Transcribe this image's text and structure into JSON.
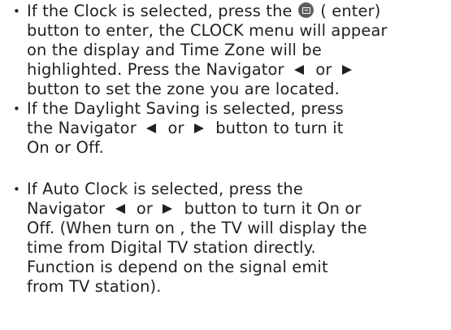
{
  "bullet_symbol": "•",
  "icons": {
    "enter": "enter-button-icon",
    "left": "navigator-left-icon",
    "right": "navigator-right-icon"
  },
  "items": [
    {
      "lines": [
        {
          "a": "If the Clock is selected, press the ",
          "b": " ( enter)"
        },
        {
          "a": "button to enter, the CLOCK menu will appear"
        },
        {
          "a": "on the display and Time Zone will be"
        },
        {
          "a": "highlighted. Press the Navigator ",
          "b": " or "
        },
        {
          "a": "button to set the zone you are located."
        }
      ]
    },
    {
      "lines": [
        {
          "a": "If the Daylight Saving is selected, press"
        },
        {
          "a": "the Navigator ",
          "b": " or ",
          "c": " button to turn it"
        },
        {
          "a": "On or Off."
        }
      ]
    },
    {
      "lines": [
        {
          "a": "If Auto Clock is selected, press the"
        },
        {
          "a": "Navigator ",
          "b": " or ",
          "c": " button to turn it On or"
        },
        {
          "a": "Off. (When turn on , the TV will display the"
        },
        {
          "a": "time from Digital TV station directly."
        },
        {
          "a": "Function is depend on the signal emit"
        },
        {
          "a": "from TV station)."
        }
      ]
    }
  ]
}
